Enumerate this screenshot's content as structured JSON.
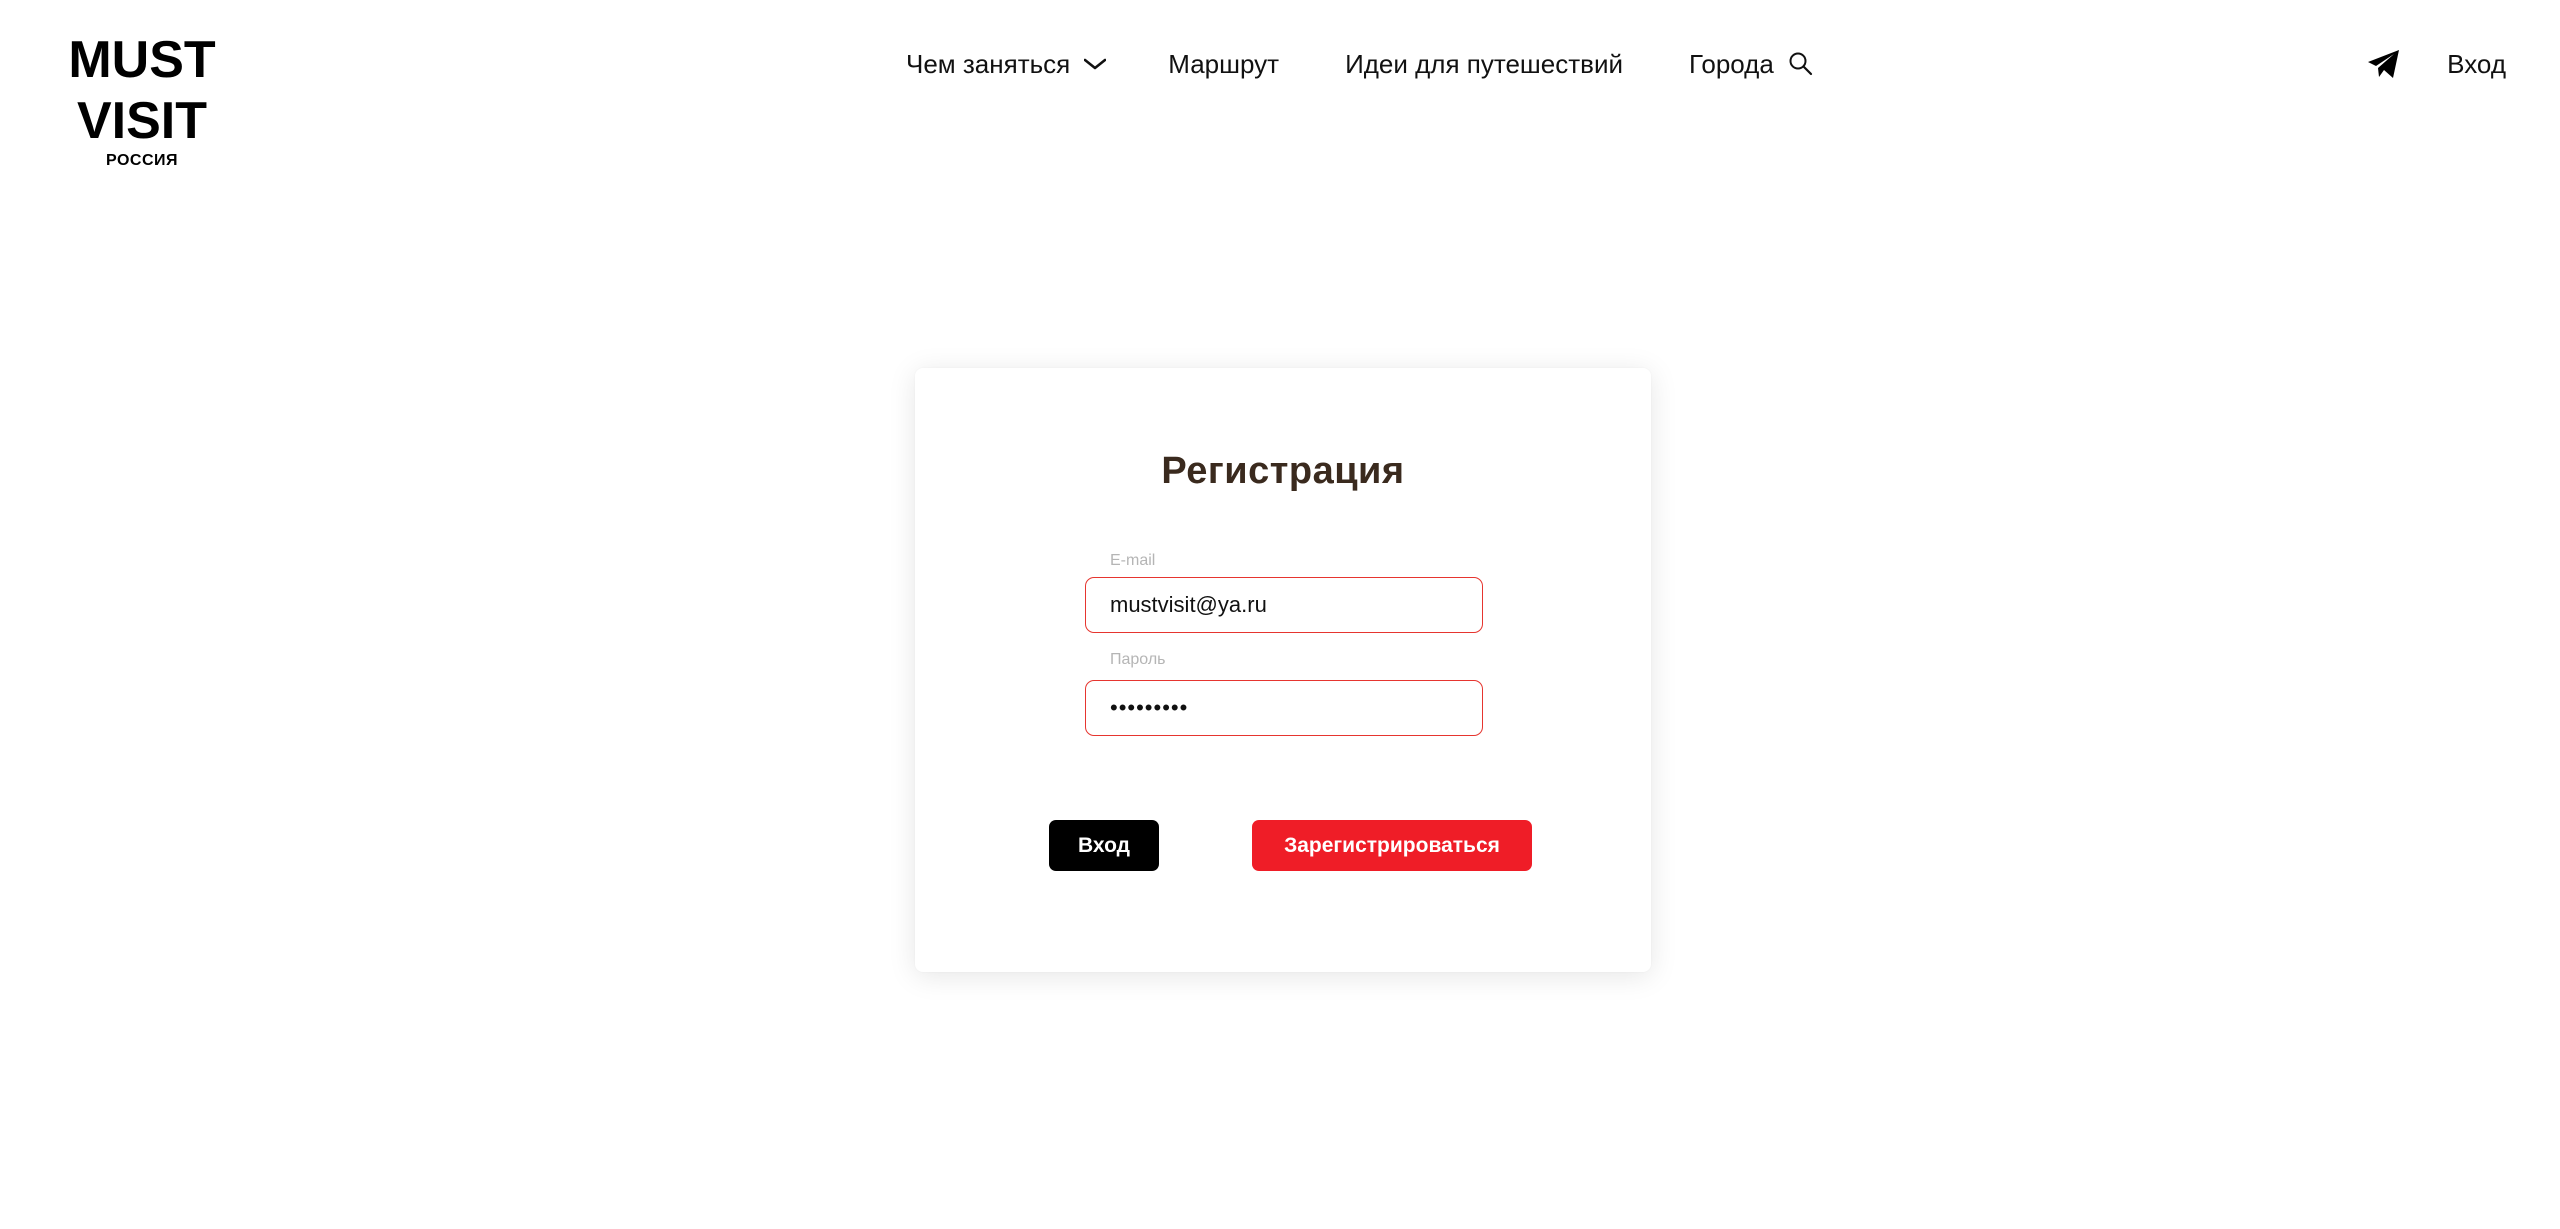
{
  "brand": {
    "line1": "MUST",
    "line2": "VISIT",
    "subtitle": "РОССИЯ"
  },
  "nav": {
    "items": [
      {
        "label": "Чем заняться",
        "icon": "chevron-down-icon"
      },
      {
        "label": "Маршрут"
      },
      {
        "label": "Идеи для путешествий"
      },
      {
        "label": "Города",
        "icon": "search-icon"
      }
    ]
  },
  "header_right": {
    "telegram_icon": "telegram-icon",
    "login_label": "Вход"
  },
  "form": {
    "title": "Регистрация",
    "email_label": "E-mail",
    "email_value": "mustvisit@ya.ru",
    "password_label": "Пароль",
    "password_value": "•••••••••",
    "login_button": "Вход",
    "register_button": "Зарегистрироваться"
  },
  "colors": {
    "accent_red": "#ef1d27",
    "input_border": "#e6352f",
    "title_brown": "#3a2a1e",
    "black": "#000000"
  }
}
